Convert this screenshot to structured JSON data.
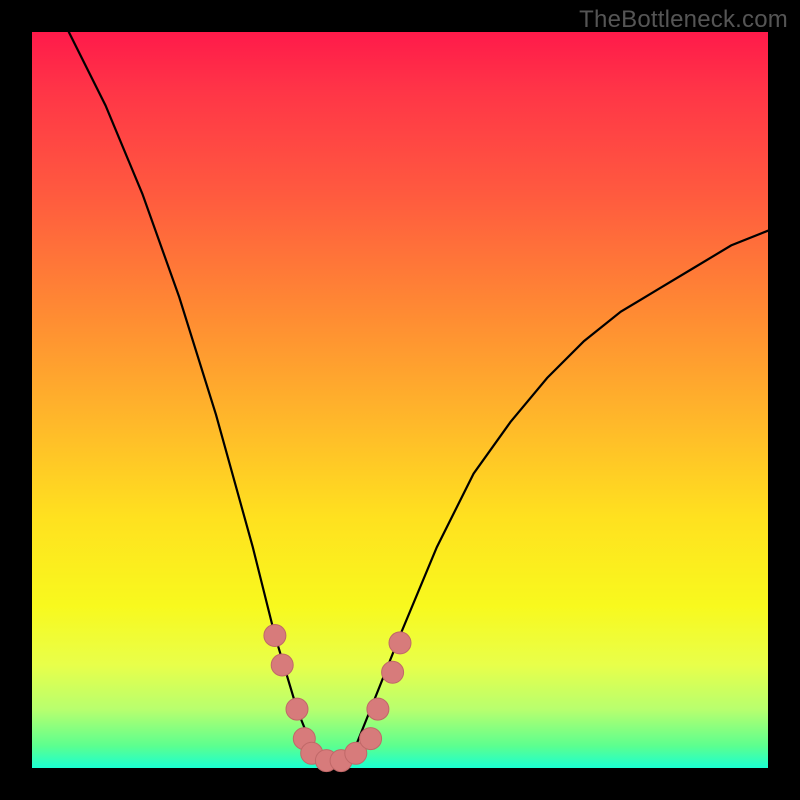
{
  "watermark": "TheBottleneck.com",
  "chart_data": {
    "type": "line",
    "title": "",
    "xlabel": "",
    "ylabel": "",
    "xlim": [
      0,
      100
    ],
    "ylim": [
      0,
      100
    ],
    "series": [
      {
        "name": "curve",
        "x": [
          5,
          10,
          15,
          20,
          25,
          30,
          33,
          36,
          38,
          40,
          42,
          44,
          46,
          50,
          55,
          60,
          65,
          70,
          75,
          80,
          85,
          90,
          95,
          100
        ],
        "y": [
          100,
          90,
          78,
          64,
          48,
          30,
          18,
          8,
          3,
          1,
          1,
          3,
          8,
          18,
          30,
          40,
          47,
          53,
          58,
          62,
          65,
          68,
          71,
          73
        ]
      }
    ],
    "markers": {
      "name": "highlight-ring",
      "color": "#d77b7b",
      "points": [
        {
          "x": 33,
          "y": 18
        },
        {
          "x": 34,
          "y": 14
        },
        {
          "x": 36,
          "y": 8
        },
        {
          "x": 37,
          "y": 4
        },
        {
          "x": 38,
          "y": 2
        },
        {
          "x": 40,
          "y": 1
        },
        {
          "x": 42,
          "y": 1
        },
        {
          "x": 44,
          "y": 2
        },
        {
          "x": 46,
          "y": 4
        },
        {
          "x": 47,
          "y": 8
        },
        {
          "x": 49,
          "y": 13
        },
        {
          "x": 50,
          "y": 17
        }
      ]
    },
    "note": "Values estimated from pixel positions; x in percent of plot width, y in percent of plot height (0 at bottom)."
  }
}
